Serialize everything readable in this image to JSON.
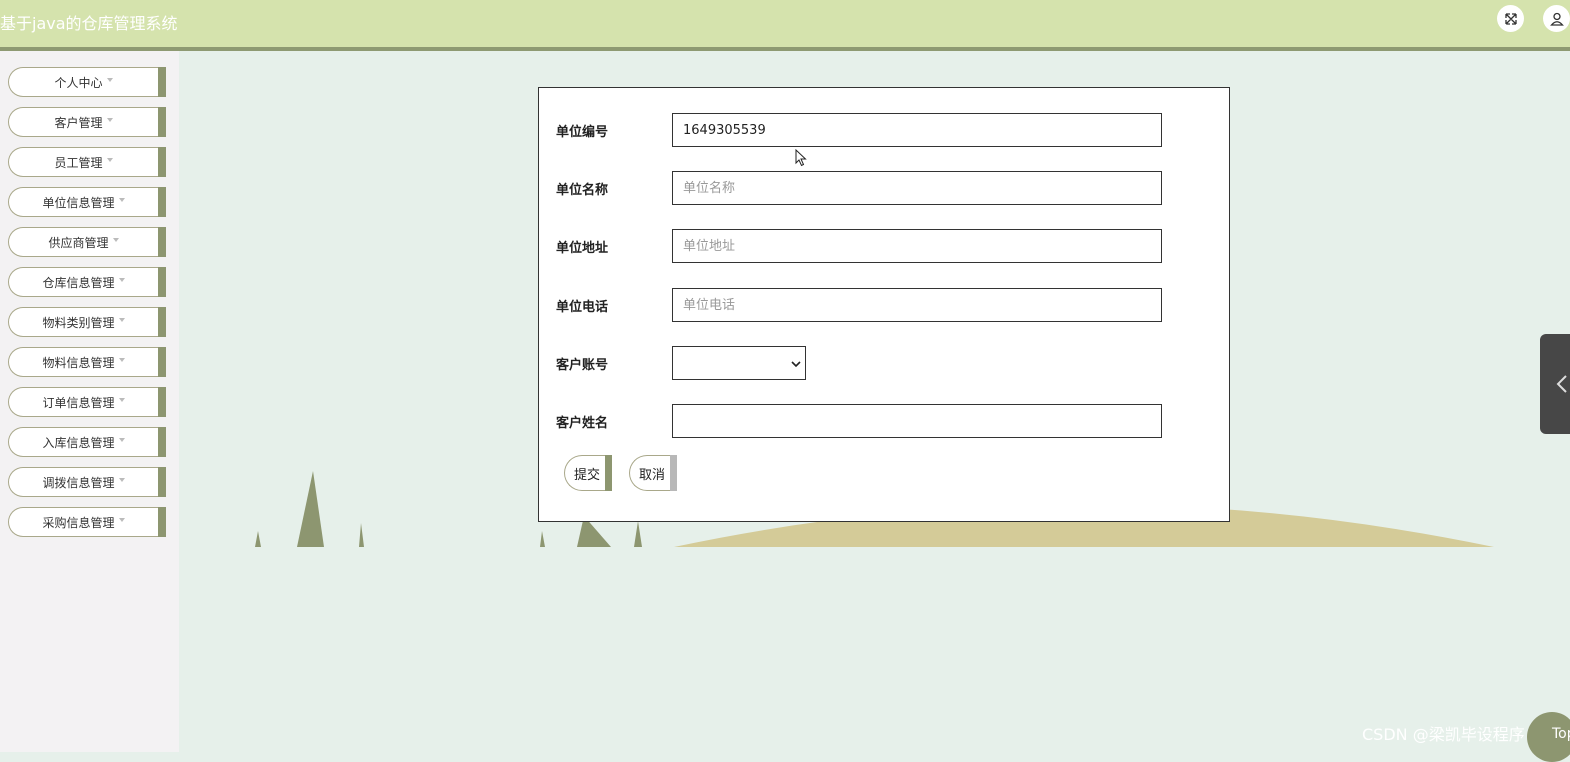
{
  "app": {
    "title": "基于java的仓库管理系统"
  },
  "header_icons": [
    "fullscreen-icon",
    "user-icon"
  ],
  "sidebar": {
    "items": [
      {
        "label": "个人中心"
      },
      {
        "label": "客户管理"
      },
      {
        "label": "员工管理"
      },
      {
        "label": "单位信息管理"
      },
      {
        "label": "供应商管理"
      },
      {
        "label": "仓库信息管理"
      },
      {
        "label": "物料类别管理"
      },
      {
        "label": "物料信息管理"
      },
      {
        "label": "订单信息管理"
      },
      {
        "label": "入库信息管理"
      },
      {
        "label": "调拨信息管理"
      },
      {
        "label": "采购信息管理"
      }
    ]
  },
  "form": {
    "unit_no": {
      "label": "单位编号",
      "value": "1649305539"
    },
    "unit_name": {
      "label": "单位名称",
      "placeholder": "单位名称",
      "value": ""
    },
    "unit_address": {
      "label": "单位地址",
      "placeholder": "单位地址",
      "value": ""
    },
    "unit_phone": {
      "label": "单位电话",
      "placeholder": "单位电话",
      "value": ""
    },
    "customer_account": {
      "label": "客户账号",
      "value": ""
    },
    "customer_name": {
      "label": "客户姓名",
      "value": ""
    },
    "submit_label": "提交",
    "cancel_label": "取消"
  },
  "colors": {
    "header_bg": "#d5e3ad",
    "accent": "#8d9670",
    "page_bg": "#e6f0ea",
    "hill": "#d4cb98",
    "tree": "#8d9670"
  },
  "watermark": "CSDN @梁凯毕设程序",
  "back_to_top_label": "Top"
}
